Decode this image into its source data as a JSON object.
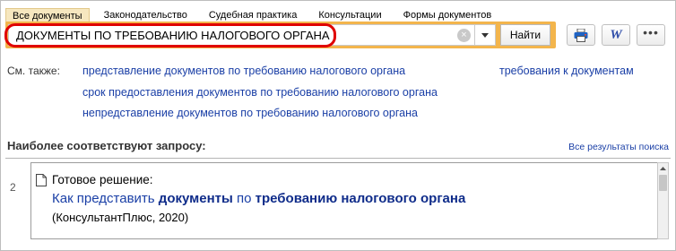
{
  "tabs": [
    {
      "label": "Все документы",
      "active": true
    },
    {
      "label": "Законодательство",
      "active": false
    },
    {
      "label": "Судебная практика",
      "active": false
    },
    {
      "label": "Консультации",
      "active": false
    },
    {
      "label": "Формы документов",
      "active": false
    }
  ],
  "search": {
    "value": "ДОКУМЕНТЫ ПО ТРЕБОВАНИЮ НАЛОГОВОГО ОРГАНА",
    "clear_symbol": "×",
    "find_label": "Найти"
  },
  "toolbar": {
    "print_icon": "printer-icon",
    "word_letter": "W",
    "more_symbol": "•••"
  },
  "see_also": {
    "label": "См. также:",
    "links": [
      "представление документов по требованию налогового органа",
      "срок предоставления документов по требованию налогового органа",
      "непредставление документов по требованию налогового органа",
      "требования к документам"
    ]
  },
  "results": {
    "header": "Наиболее соответствуют запросу:",
    "all_results_label": "Все результаты поиска",
    "items": [
      {
        "number": "2",
        "type": "Готовое решение:",
        "title_parts": [
          "Как представить ",
          "документы",
          " по ",
          "требованию налогового органа"
        ],
        "source": "(КонсультантПлюс, 2020)"
      }
    ]
  },
  "colors": {
    "search_frame": "#f3b54c",
    "highlight_ring": "#e00000",
    "link": "#1a3fa6",
    "active_tab": "#f6e7bf"
  }
}
